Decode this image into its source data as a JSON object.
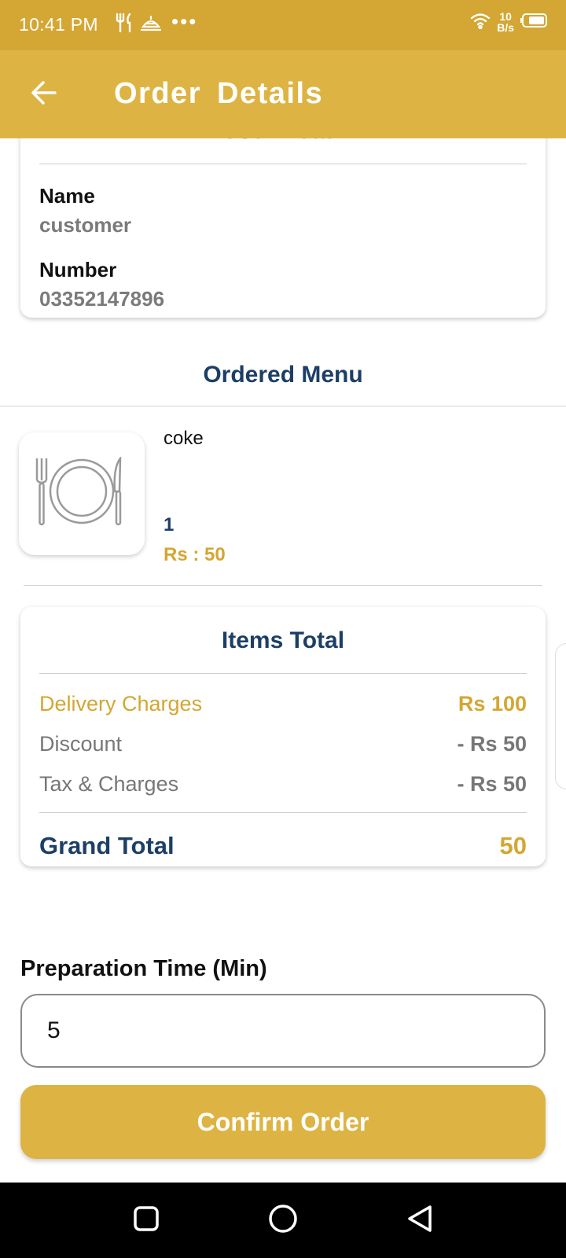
{
  "status_bar": {
    "time": "10:41 PM",
    "dots": "•••",
    "net_speed_value": "10",
    "net_speed_unit": "B/s",
    "icons": [
      "restaurant-icon",
      "food-tray-icon",
      "wifi-icon",
      "battery-icon"
    ]
  },
  "app_bar": {
    "title": "Order  Details",
    "back_icon": "arrow-back-icon"
  },
  "user_detail": {
    "heading": "User Detail",
    "name_label": "Name",
    "name_value": "customer",
    "number_label": "Number",
    "number_value": "03352147896"
  },
  "ordered_menu": {
    "heading": "Ordered Menu",
    "items": [
      {
        "name": "coke",
        "quantity": "1",
        "price": "Rs : 50",
        "icon": "plate-cutlery-icon"
      }
    ]
  },
  "items_total": {
    "heading": "Items Total",
    "delivery_label": "Delivery Charges",
    "delivery_value": "Rs 100",
    "discount_label": "Discount",
    "discount_value": "- Rs 50",
    "tax_label": "Tax & Charges",
    "tax_value": "- Rs 50",
    "grand_label": "Grand Total",
    "grand_value": "50"
  },
  "preparation": {
    "label": "Preparation Time (Min)",
    "value": "5"
  },
  "confirm_button": {
    "label": "Confirm Order"
  },
  "colors": {
    "status_bar": "#d4a633",
    "app_bar": "#ddb443",
    "navy": "#1d3f66",
    "gold": "#d4a633"
  }
}
